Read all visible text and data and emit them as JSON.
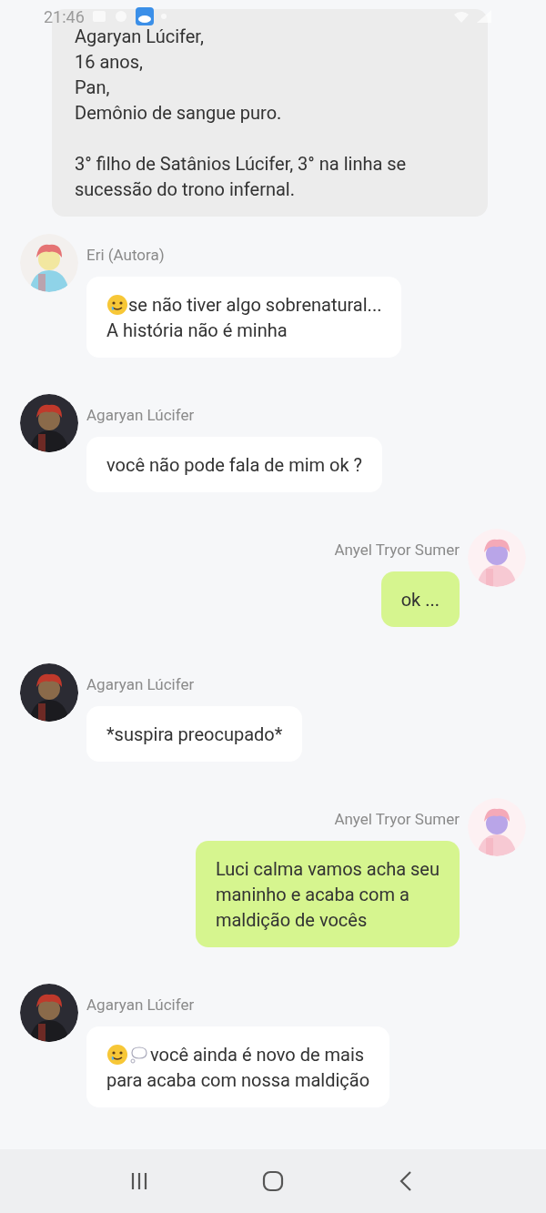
{
  "status_bar": {
    "time": "21:46"
  },
  "messages": [
    {
      "kind": "info",
      "text": "Agaryan Lúcifer,\n16 anos,\nPan,\nDemônio de sangue puro.\n\n3° filho de Satânios Lúcifer, 3° na linha se sucessão do trono infernal."
    },
    {
      "kind": "chat",
      "outgoing": false,
      "author": "Eri (Autora)",
      "tear_emoji": true,
      "thought_emoji": false,
      "text": "se não tiver algo sobrenatural...\nA história não é  minha"
    },
    {
      "kind": "chat",
      "outgoing": false,
      "author": "Agaryan Lúcifer",
      "tear_emoji": false,
      "thought_emoji": false,
      "text": "você não pode fala de mim ok ?"
    },
    {
      "kind": "chat",
      "outgoing": true,
      "author": "Anyel Tryor Sumer",
      "tear_emoji": false,
      "thought_emoji": false,
      "text": "ok ..."
    },
    {
      "kind": "chat",
      "outgoing": false,
      "author": "Agaryan Lúcifer",
      "tear_emoji": false,
      "thought_emoji": false,
      "text": "*suspira preocupado*"
    },
    {
      "kind": "chat",
      "outgoing": true,
      "author": "Anyel Tryor Sumer",
      "tear_emoji": false,
      "thought_emoji": false,
      "text": "Luci calma vamos acha seu\nmaninho e acaba com a\nmaldição de vocês"
    },
    {
      "kind": "chat",
      "outgoing": false,
      "author": "Agaryan Lúcifer",
      "tear_emoji": true,
      "thought_emoji": true,
      "text": "você ainda é novo de mais\npara acaba com nossa maldição"
    }
  ]
}
